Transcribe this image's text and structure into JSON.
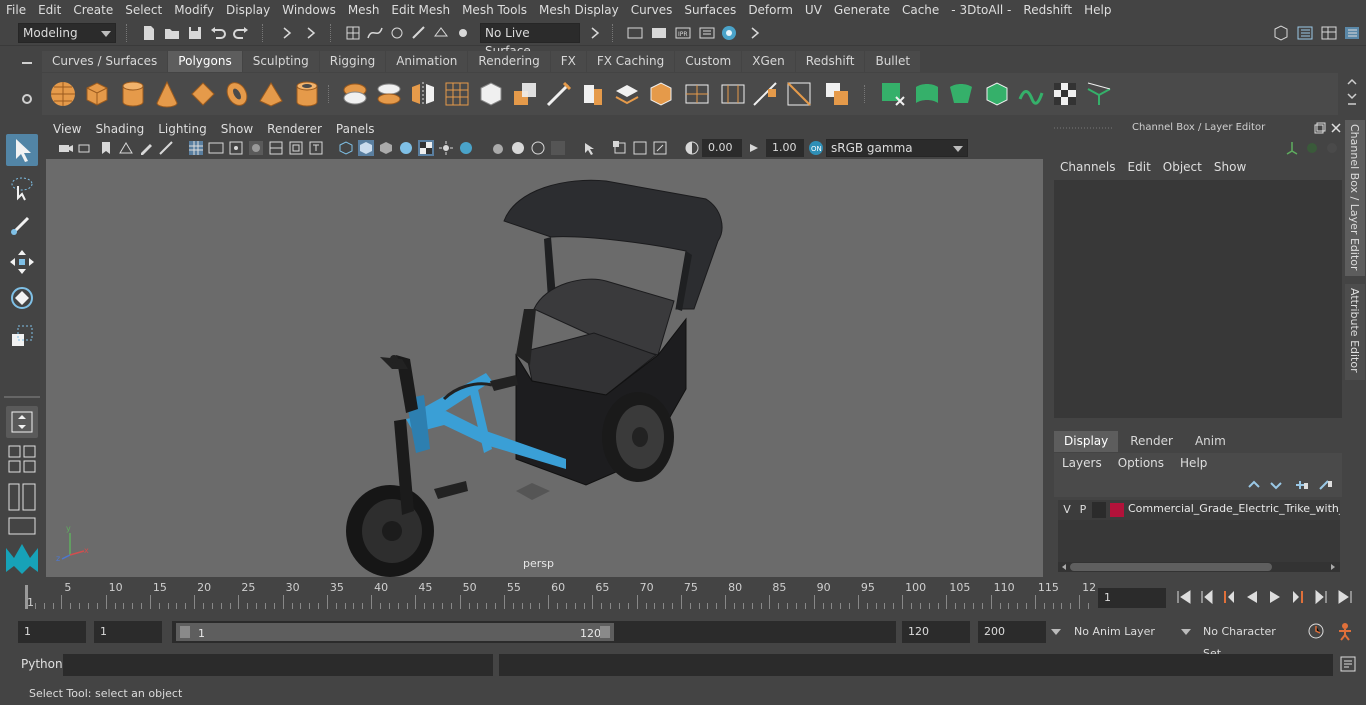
{
  "menubar": {
    "items": [
      "File",
      "Edit",
      "Create",
      "Select",
      "Modify",
      "Display",
      "Windows",
      "Mesh",
      "Edit Mesh",
      "Mesh Tools",
      "Mesh Display",
      "Curves",
      "Surfaces",
      "Deform",
      "UV",
      "Generate",
      "Cache",
      "- 3DtoAll -",
      "Redshift",
      "Help"
    ]
  },
  "statusline": {
    "mode": "Modeling",
    "live_surface": "No Live Surface"
  },
  "shelf": {
    "tabs": [
      "Curves / Surfaces",
      "Polygons",
      "Sculpting",
      "Rigging",
      "Animation",
      "Rendering",
      "FX",
      "FX Caching",
      "Custom",
      "XGen",
      "Redshift",
      "Bullet"
    ],
    "active_tab": "Polygons"
  },
  "viewport": {
    "menu": [
      "View",
      "Shading",
      "Lighting",
      "Show",
      "Renderer",
      "Panels"
    ],
    "exposure": "0.00",
    "gamma": "1.00",
    "color_space": "sRGB gamma",
    "camera_label": "persp"
  },
  "channel_box": {
    "title": "Channel Box / Layer Editor",
    "menu": [
      "Channels",
      "Edit",
      "Object",
      "Show"
    ],
    "side_tabs": [
      "Channel Box / Layer Editor",
      "Attribute Editor"
    ]
  },
  "layer_editor": {
    "tabs": [
      "Display",
      "Render",
      "Anim"
    ],
    "active_tab": "Display",
    "menu": [
      "Layers",
      "Options",
      "Help"
    ],
    "layers": [
      {
        "visible": "V",
        "playback": "P",
        "color": "#b3123a",
        "name": "Commercial_Grade_Electric_Trike_with_Passenger_Cabin"
      }
    ]
  },
  "timeline": {
    "ticks": [
      "1",
      "5",
      "10",
      "15",
      "20",
      "25",
      "30",
      "35",
      "40",
      "45",
      "50",
      "55",
      "60",
      "65",
      "70",
      "75",
      "80",
      "85",
      "90",
      "95",
      "100",
      "105",
      "110",
      "115",
      "12"
    ],
    "current_time": "1"
  },
  "range": {
    "start_field": "1",
    "current_field": "1",
    "slider_start": "1",
    "slider_end": "120",
    "end_field": "120",
    "max_field": "200",
    "anim_layer": "No Anim Layer",
    "character_set": "No Character Set"
  },
  "command_line": {
    "label": "Python"
  },
  "help_line": {
    "text": "Select Tool: select an object"
  },
  "colors": {
    "accent": "#5285a6",
    "frame_blue": "#3a9fd6",
    "layer_red": "#b3123a"
  }
}
